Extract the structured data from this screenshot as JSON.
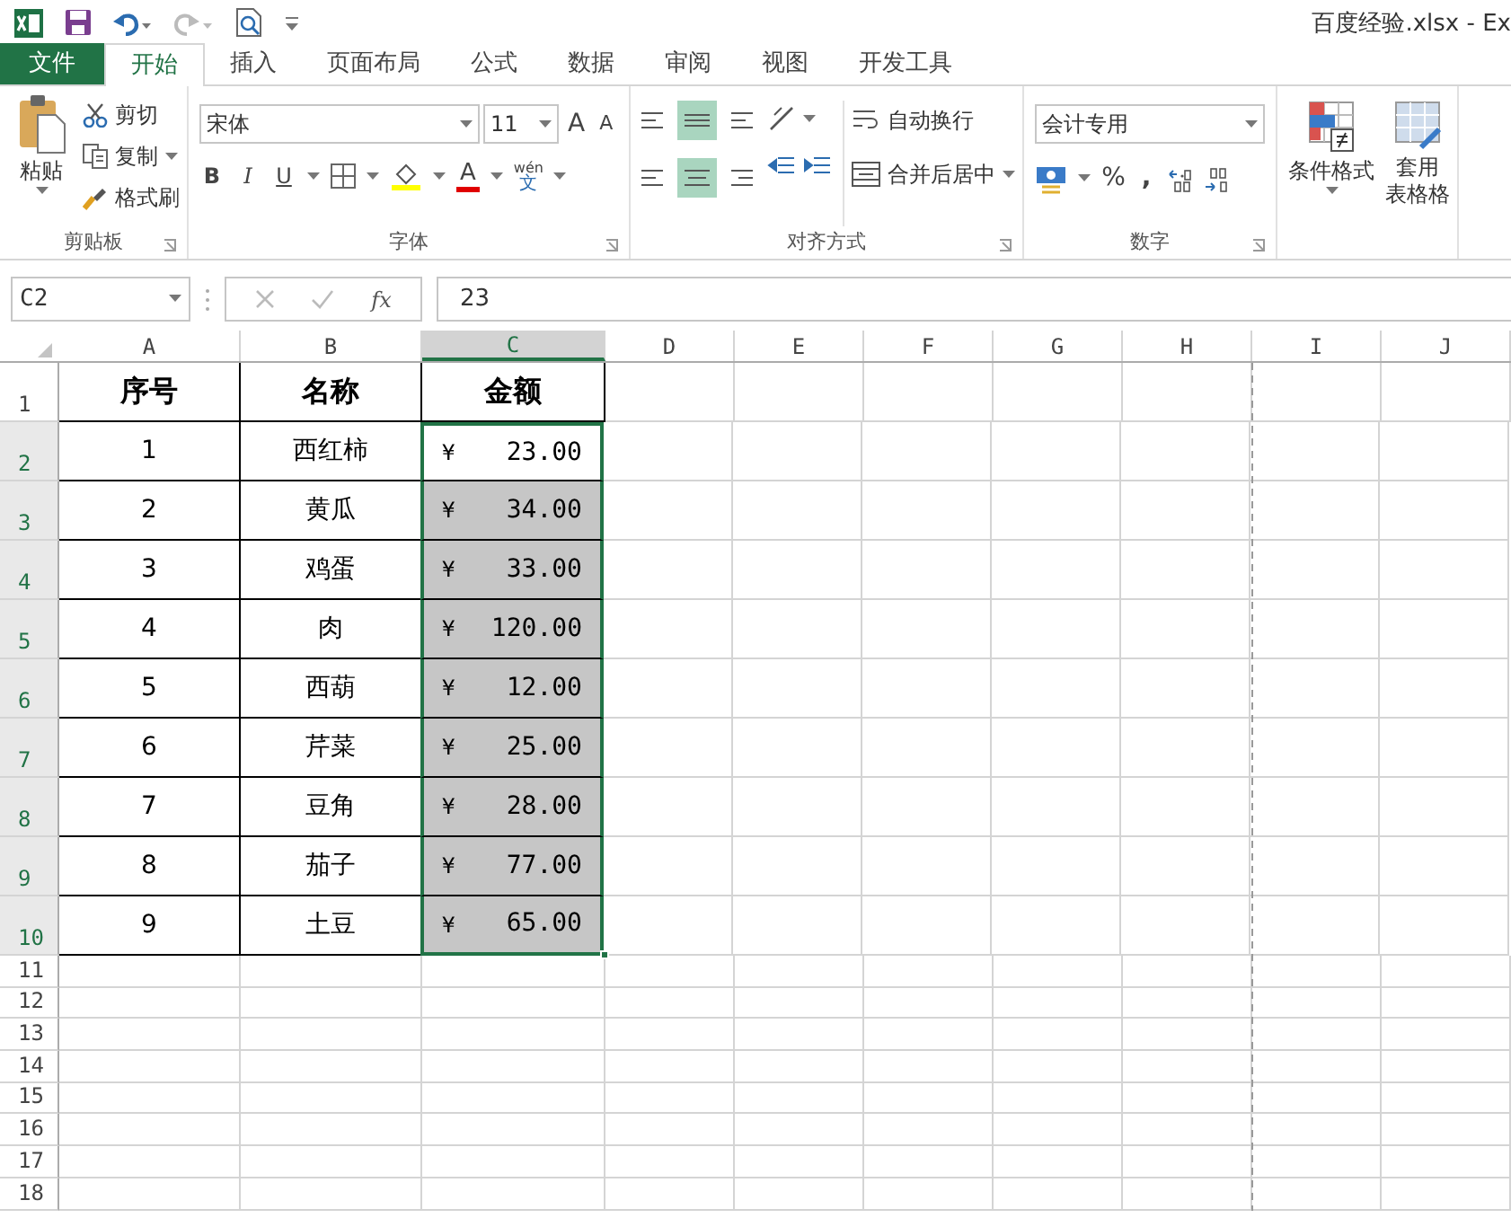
{
  "window": {
    "title": "百度经验.xlsx - Ex"
  },
  "tabs": [
    {
      "label": "文件",
      "kind": "file",
      "selected": false
    },
    {
      "label": "开始",
      "kind": "tab",
      "selected": true
    },
    {
      "label": "插入",
      "kind": "tab",
      "selected": false
    },
    {
      "label": "页面布局",
      "kind": "tab",
      "selected": false
    },
    {
      "label": "公式",
      "kind": "tab",
      "selected": false
    },
    {
      "label": "数据",
      "kind": "tab",
      "selected": false
    },
    {
      "label": "审阅",
      "kind": "tab",
      "selected": false
    },
    {
      "label": "视图",
      "kind": "tab",
      "selected": false
    },
    {
      "label": "开发工具",
      "kind": "tab",
      "selected": false
    }
  ],
  "ribbon": {
    "clipboard": {
      "paste": "粘贴",
      "cut": "剪切",
      "copy": "复制",
      "format_painter": "格式刷",
      "label": "剪贴板"
    },
    "font": {
      "name": "宋体",
      "size": "11",
      "grow": "A",
      "shrink": "A",
      "bold": "B",
      "italic": "I",
      "underline": "U",
      "font_color": "A",
      "phonetic_top": "wén",
      "phonetic_bottom": "文",
      "label": "字体"
    },
    "alignment": {
      "wrap": "自动换行",
      "merge": "合并后居中",
      "label": "对齐方式"
    },
    "number": {
      "format": "会计专用",
      "percent": "%",
      "comma": ",",
      "label": "数字"
    },
    "styles": {
      "conditional": "条件格式",
      "table_top": "套用",
      "table_bottom": "表格格"
    }
  },
  "formula_bar": {
    "name_box": "C2",
    "fx": "fx",
    "value": "23"
  },
  "sheet": {
    "columns": [
      {
        "label": "A",
        "selected": false
      },
      {
        "label": "B",
        "selected": false
      },
      {
        "label": "C",
        "selected": true
      },
      {
        "label": "D",
        "selected": false
      },
      {
        "label": "E",
        "selected": false
      },
      {
        "label": "F",
        "selected": false
      },
      {
        "label": "G",
        "selected": false
      },
      {
        "label": "H",
        "selected": false
      },
      {
        "label": "I",
        "selected": false
      },
      {
        "label": "J",
        "selected": false
      }
    ],
    "header_cells": [
      "序号",
      "名称",
      "金额"
    ],
    "data": [
      {
        "no": "1",
        "name": "西红柿",
        "currency": "¥",
        "amount": "23.00",
        "selected": true,
        "active": true
      },
      {
        "no": "2",
        "name": "黄瓜",
        "currency": "¥",
        "amount": "34.00",
        "selected": true,
        "active": false
      },
      {
        "no": "3",
        "name": "鸡蛋",
        "currency": "¥",
        "amount": "33.00",
        "selected": true,
        "active": false
      },
      {
        "no": "4",
        "name": "肉",
        "currency": "¥",
        "amount": "120.00",
        "selected": true,
        "active": false
      },
      {
        "no": "5",
        "name": "西葫",
        "currency": "¥",
        "amount": "12.00",
        "selected": true,
        "active": false
      },
      {
        "no": "6",
        "name": "芹菜",
        "currency": "¥",
        "amount": "25.00",
        "selected": true,
        "active": false
      },
      {
        "no": "7",
        "name": "豆角",
        "currency": "¥",
        "amount": "28.00",
        "selected": true,
        "active": false
      },
      {
        "no": "8",
        "name": "茄子",
        "currency": "¥",
        "amount": "77.00",
        "selected": true,
        "active": false
      },
      {
        "no": "9",
        "name": "土豆",
        "currency": "¥",
        "amount": "65.00",
        "selected": true,
        "active": false
      }
    ],
    "row_headers": [
      {
        "label": "1",
        "selected": false
      },
      {
        "label": "2",
        "selected": true
      },
      {
        "label": "3",
        "selected": true
      },
      {
        "label": "4",
        "selected": true
      },
      {
        "label": "5",
        "selected": true
      },
      {
        "label": "6",
        "selected": true
      },
      {
        "label": "7",
        "selected": true
      },
      {
        "label": "8",
        "selected": true
      },
      {
        "label": "9",
        "selected": true
      },
      {
        "label": "10",
        "selected": true
      },
      {
        "label": "11",
        "selected": false
      },
      {
        "label": "12",
        "selected": false
      },
      {
        "label": "13",
        "selected": false
      },
      {
        "label": "14",
        "selected": false
      },
      {
        "label": "15",
        "selected": false
      },
      {
        "label": "16",
        "selected": false
      },
      {
        "label": "17",
        "selected": false
      },
      {
        "label": "18",
        "selected": false
      }
    ]
  }
}
